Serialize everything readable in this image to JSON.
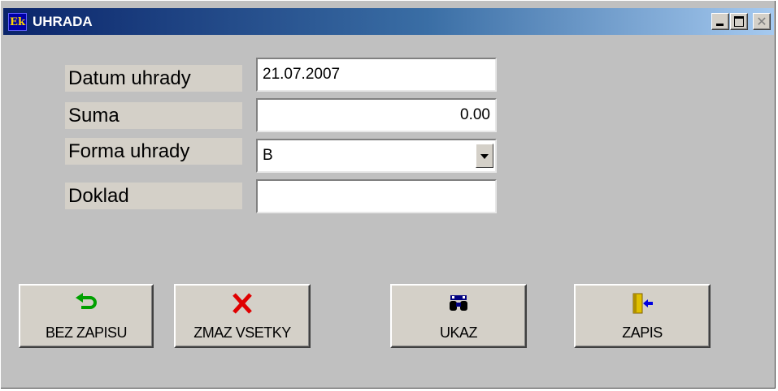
{
  "window": {
    "title": "UHRADA",
    "app_icon_text": "Ek",
    "controls": {
      "close_glyph": "✕"
    }
  },
  "form": {
    "datum_label": "Datum uhrady",
    "datum_value": "21.07.2007",
    "suma_label": "Suma",
    "suma_value": "0.00",
    "forma_label": "Forma uhrady",
    "forma_value": "B",
    "doklad_label": "Doklad",
    "doklad_value": ""
  },
  "buttons": {
    "bez_zapisu": {
      "label": "BEZ ZAPISU",
      "icon": "undo-arrow-icon",
      "icon_color": "#00a000"
    },
    "zmaz_vsetky": {
      "label": "ZMAZ VSETKY",
      "icon": "red-x-icon",
      "icon_color": "#e00000"
    },
    "ukaz": {
      "label": "UKAZ",
      "icon": "binoculars-icon",
      "icon_color": "#000080"
    },
    "zapis": {
      "label": "ZAPIS",
      "icon": "door-exit-icon",
      "icon_color": "#e0c000"
    }
  }
}
